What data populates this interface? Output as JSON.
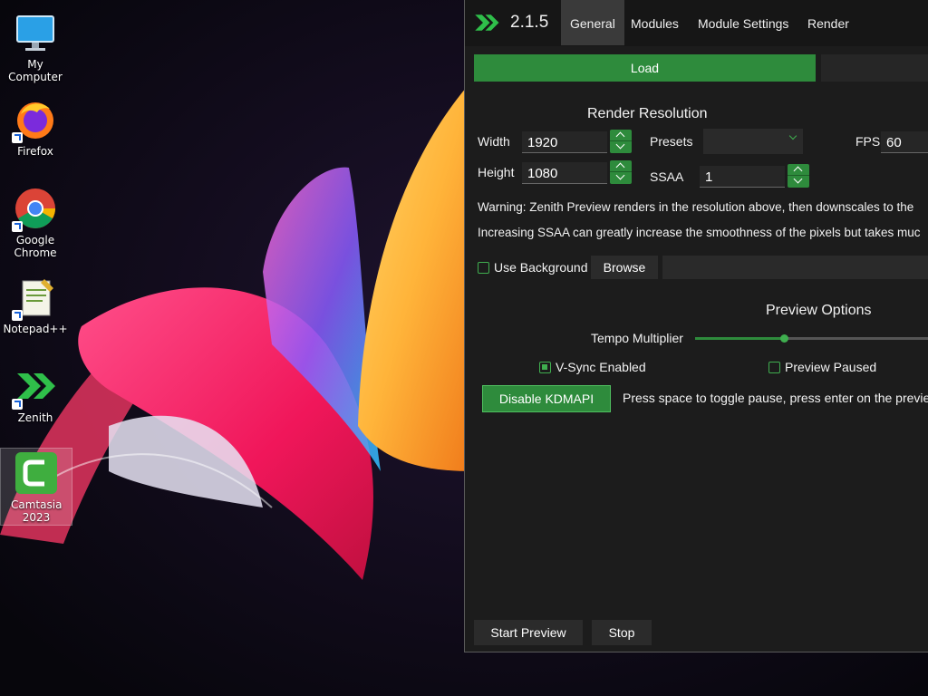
{
  "desktop": {
    "icons": [
      {
        "label": "My Computer",
        "icon": "monitor-icon"
      },
      {
        "label": "Firefox",
        "icon": "firefox-icon"
      },
      {
        "label": "Google Chrome",
        "icon": "chrome-icon"
      },
      {
        "label": "Notepad++",
        "icon": "notepadpp-icon"
      },
      {
        "label": "Zenith",
        "icon": "zenith-icon"
      },
      {
        "label": "Camtasia 2023",
        "icon": "camtasia-icon",
        "selected": true
      }
    ]
  },
  "app": {
    "version": "2.1.5",
    "tabs": [
      {
        "label": "General",
        "active": true
      },
      {
        "label": "Modules"
      },
      {
        "label": "Module Settings"
      },
      {
        "label": "Render"
      }
    ],
    "load_button": "Load",
    "render_resolution": {
      "heading": "Render Resolution",
      "width_label": "Width",
      "width_value": "1920",
      "height_label": "Height",
      "height_value": "1080",
      "presets_label": "Presets",
      "presets_value": "",
      "fps_label": "FPS",
      "fps_value": "60",
      "ssaa_label": "SSAA",
      "ssaa_value": "1"
    },
    "warnings": [
      "Warning: Zenith Preview renders in the resolution above, then downscales to the",
      "Increasing SSAA can greatly increase the smoothness of the pixels but takes muc"
    ],
    "use_background": {
      "label": "Use Background",
      "checked": false
    },
    "browse_button": "Browse",
    "background_path": "",
    "preview_options": {
      "heading": "Preview Options",
      "tempo_label": "Tempo Multiplier",
      "tempo_level": 0.38,
      "vsync_label": "V-Sync Enabled",
      "vsync_checked": true,
      "paused_label": "Preview Paused",
      "paused_checked": false,
      "kdmapi_button": "Disable KDMAPI",
      "hint": "Press space to toggle pause, press enter on the preview"
    },
    "start_preview_button": "Start Preview",
    "stop_button": "Stop",
    "colors": {
      "accent": "#2e8b3c",
      "background": "#1c1c1c",
      "tab_active": "#3a3a3a"
    }
  }
}
